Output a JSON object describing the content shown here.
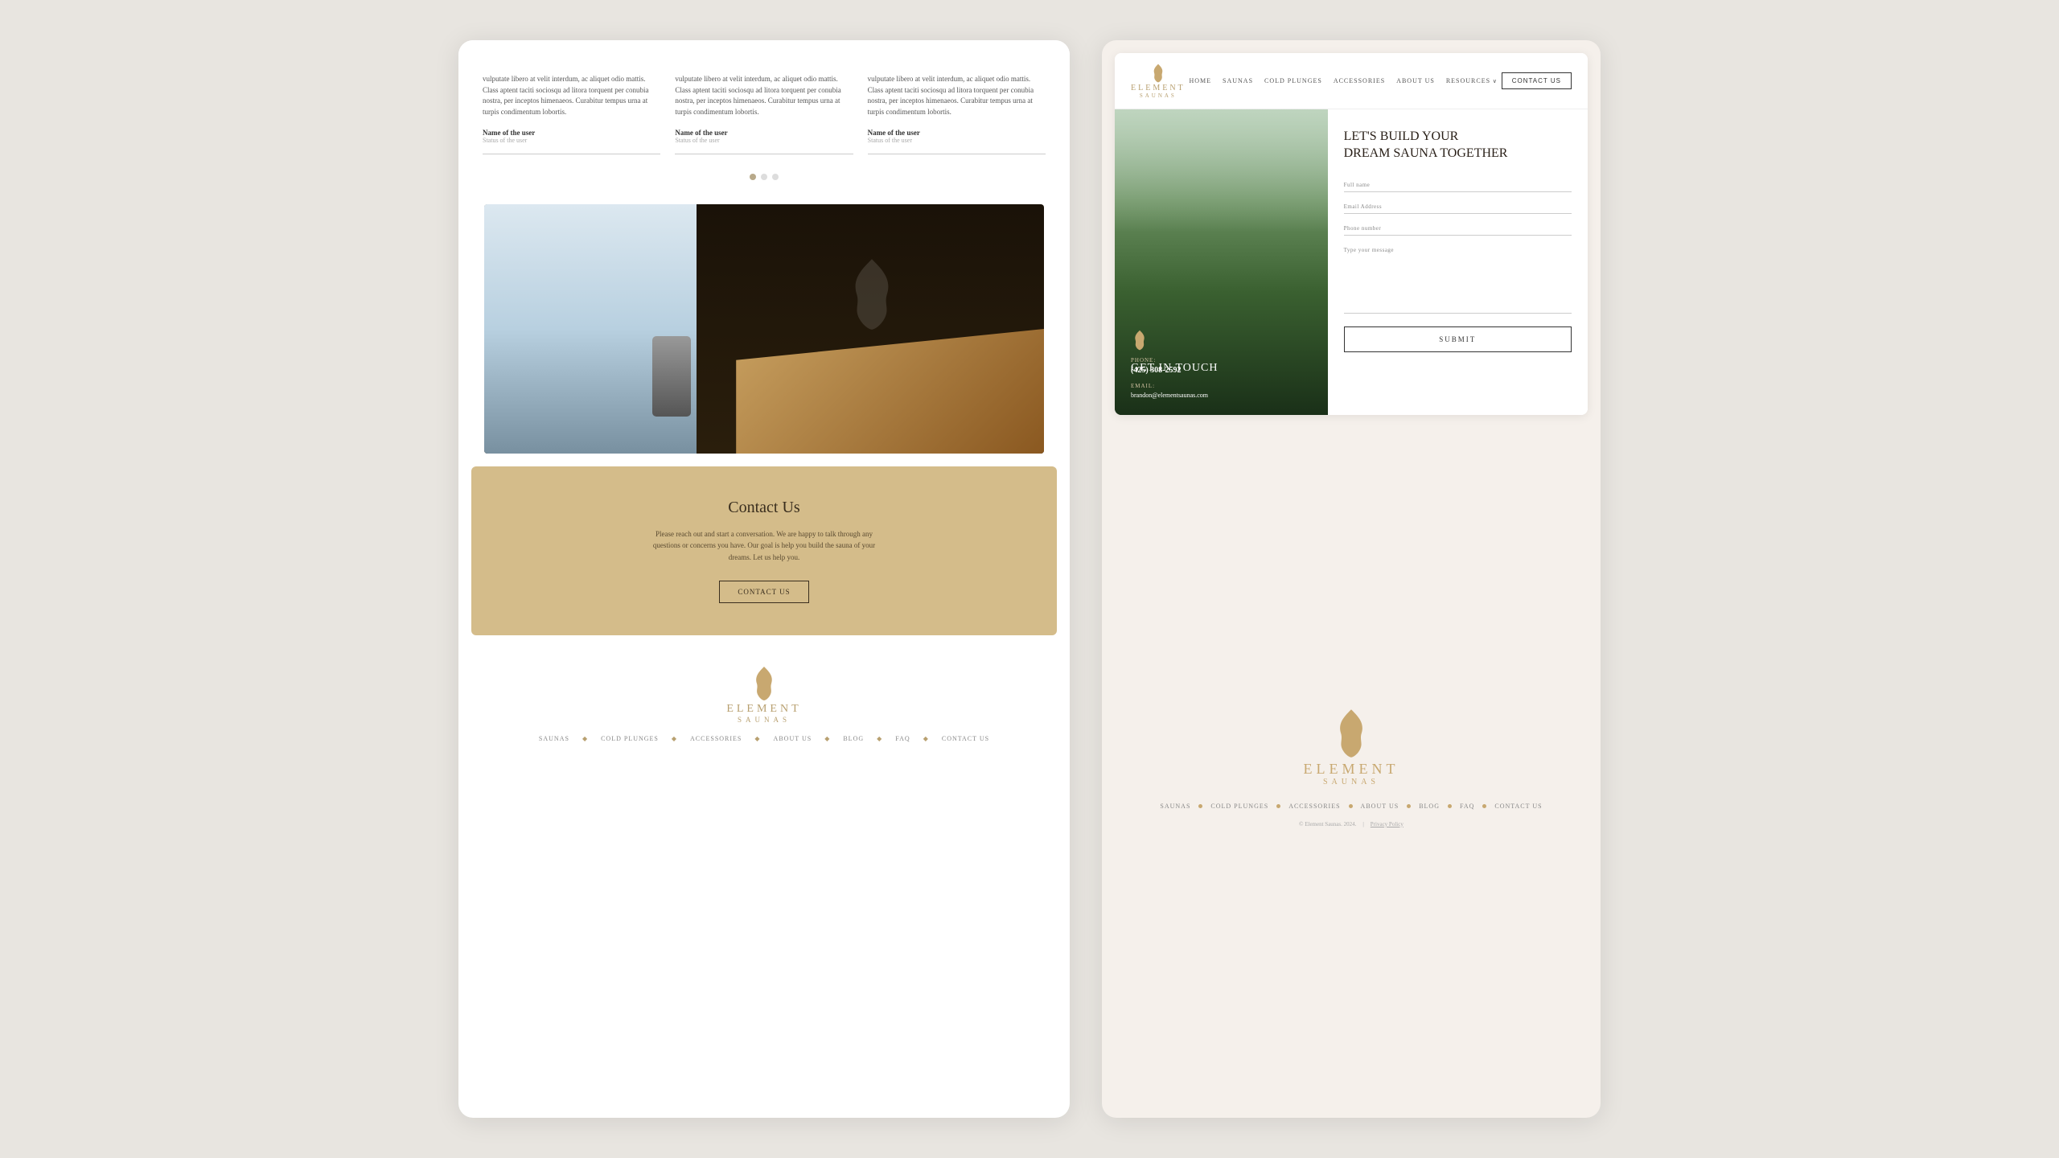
{
  "left": {
    "testimonials": [
      {
        "text": "vulputate libero at velit interdum, ac aliquet odio mattis. Class aptent taciti sociosqu ad litora torquent per conubia nostra, per inceptos himenaeos. Curabitur tempus urna at turpis condimentum lobortis.",
        "user_name": "Name of the user",
        "user_status": "Status of the user"
      },
      {
        "text": "vulputate libero at velit interdum, ac aliquet odio mattis. Class aptent taciti sociosqu ad litora torquent per conubia nostra, per inceptos himenaeos. Curabitur tempus urna at turpis condimentum lobortis.",
        "user_name": "Name of the user",
        "user_status": "Status of the user"
      },
      {
        "text": "vulputate libero at velit interdum, ac aliquet odio mattis. Class aptent taciti sociosqu ad litora torquent per conubia nostra, per inceptos himenaeos. Curabitur tempus urna at turpis condimentum lobortis.",
        "user_name": "Name of the user",
        "user_status": "Status of the user"
      }
    ],
    "contact_section": {
      "title": "Contact Us",
      "description": "Please reach out and start a conversation. We are happy to talk through any questions or concerns you have. Our goal is help you build the sauna of your dreams. Let us help you.",
      "button": "CONTACT US"
    },
    "footer": {
      "logo_text": "ELEMENT",
      "logo_sub": "SAUNAS",
      "nav_items": [
        "SAUNAS",
        "COLD PLUNGES",
        "ACCESSORIES",
        "ABOUT US",
        "BLOG",
        "FAQ",
        "CONTACT US"
      ]
    }
  },
  "right": {
    "nav": {
      "logo_text": "ELEMENT",
      "logo_sub": "SAUNAS",
      "links": [
        "HOME",
        "SAUNAS",
        "COLD PLUNGES",
        "ACCESSORIES",
        "ABOUT US",
        "RESOURCES"
      ],
      "contact_btn": "CONTACT US"
    },
    "contact_page": {
      "form_title": "LET'S BUILD YOUR\nDREAM SAUNA TOGETHER",
      "fields": {
        "full_name_label": "Full name",
        "email_label": "Email Address",
        "phone_label": "Phone number",
        "message_label": "Type your message"
      },
      "submit_btn": "SUBMIT",
      "get_in_touch": "GET IN TOUCH",
      "phone_label": "PHONE:",
      "phone_value": "(425) 308-2592",
      "email_label": "EMAIL:",
      "email_value": "brandon@elementsaunas.com"
    },
    "footer": {
      "logo_text": "ELEMENT",
      "logo_sub": "SAUNAS",
      "nav_items": [
        "SAUNAS",
        "COLD PLUNGES",
        "ACCESSORIES",
        "ABOUT US",
        "BLOG",
        "FAQ",
        "CONTACT US"
      ],
      "copyright": "© Element Saunas. 2024.",
      "privacy_policy": "Privacy Policy"
    }
  }
}
